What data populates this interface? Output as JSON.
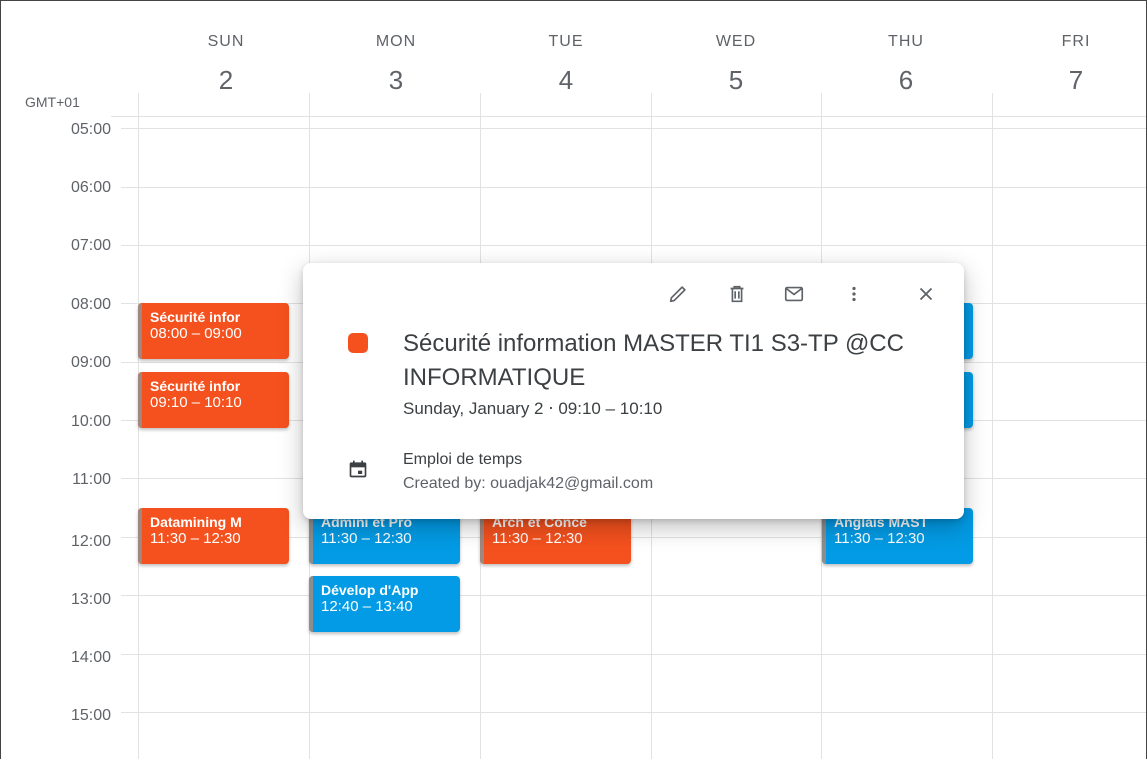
{
  "timezone": "GMT+01",
  "days": [
    {
      "dow": "SUN",
      "num": "2"
    },
    {
      "dow": "MON",
      "num": "3"
    },
    {
      "dow": "TUE",
      "num": "4"
    },
    {
      "dow": "WED",
      "num": "5"
    },
    {
      "dow": "THU",
      "num": "6"
    },
    {
      "dow": "FRI",
      "num": "7"
    }
  ],
  "hours": [
    "05:00",
    "06:00",
    "07:00",
    "08:00",
    "09:00",
    "10:00",
    "11:00",
    "12:00",
    "13:00",
    "14:00",
    "15:00"
  ],
  "events": {
    "sun_secu1": {
      "title": "Sécurité infor",
      "time": "08:00 – 09:00"
    },
    "sun_secu2": {
      "title": "Sécurité infor",
      "time": "09:10 – 10:10"
    },
    "sun_datamining": {
      "title": "Datamining M",
      "time": "11:30 – 12:30"
    },
    "mon_admin": {
      "title": "Admini et Pro",
      "time": "11:30 – 12:30"
    },
    "mon_develop": {
      "title": "Dévelop d'App",
      "time": "12:40 – 13:40"
    },
    "tue_arch": {
      "title": "Arch et Conce",
      "time": "11:30 – 12:30"
    },
    "thu_anglais": {
      "title": "Anglais MAST",
      "time": "11:30 – 12:30"
    }
  },
  "popup": {
    "title": "Sécurité information MASTER TI1 S3-TP @CC INFORMATIQUE",
    "date_line": "Sunday, January 2 ⋅ 09:10 – 10:10",
    "calendar_name": "Emploi de temps",
    "created_by": "Created by: ouadjak42@gmail.com",
    "icons": [
      "edit-icon",
      "delete-icon",
      "email-icon",
      "more-options-icon",
      "close-icon",
      "calendar-icon"
    ]
  },
  "colors": {
    "tomato": "#f4511e",
    "peacock": "#039be5",
    "grid": "#e2e2e2",
    "text": "#3c4043"
  }
}
